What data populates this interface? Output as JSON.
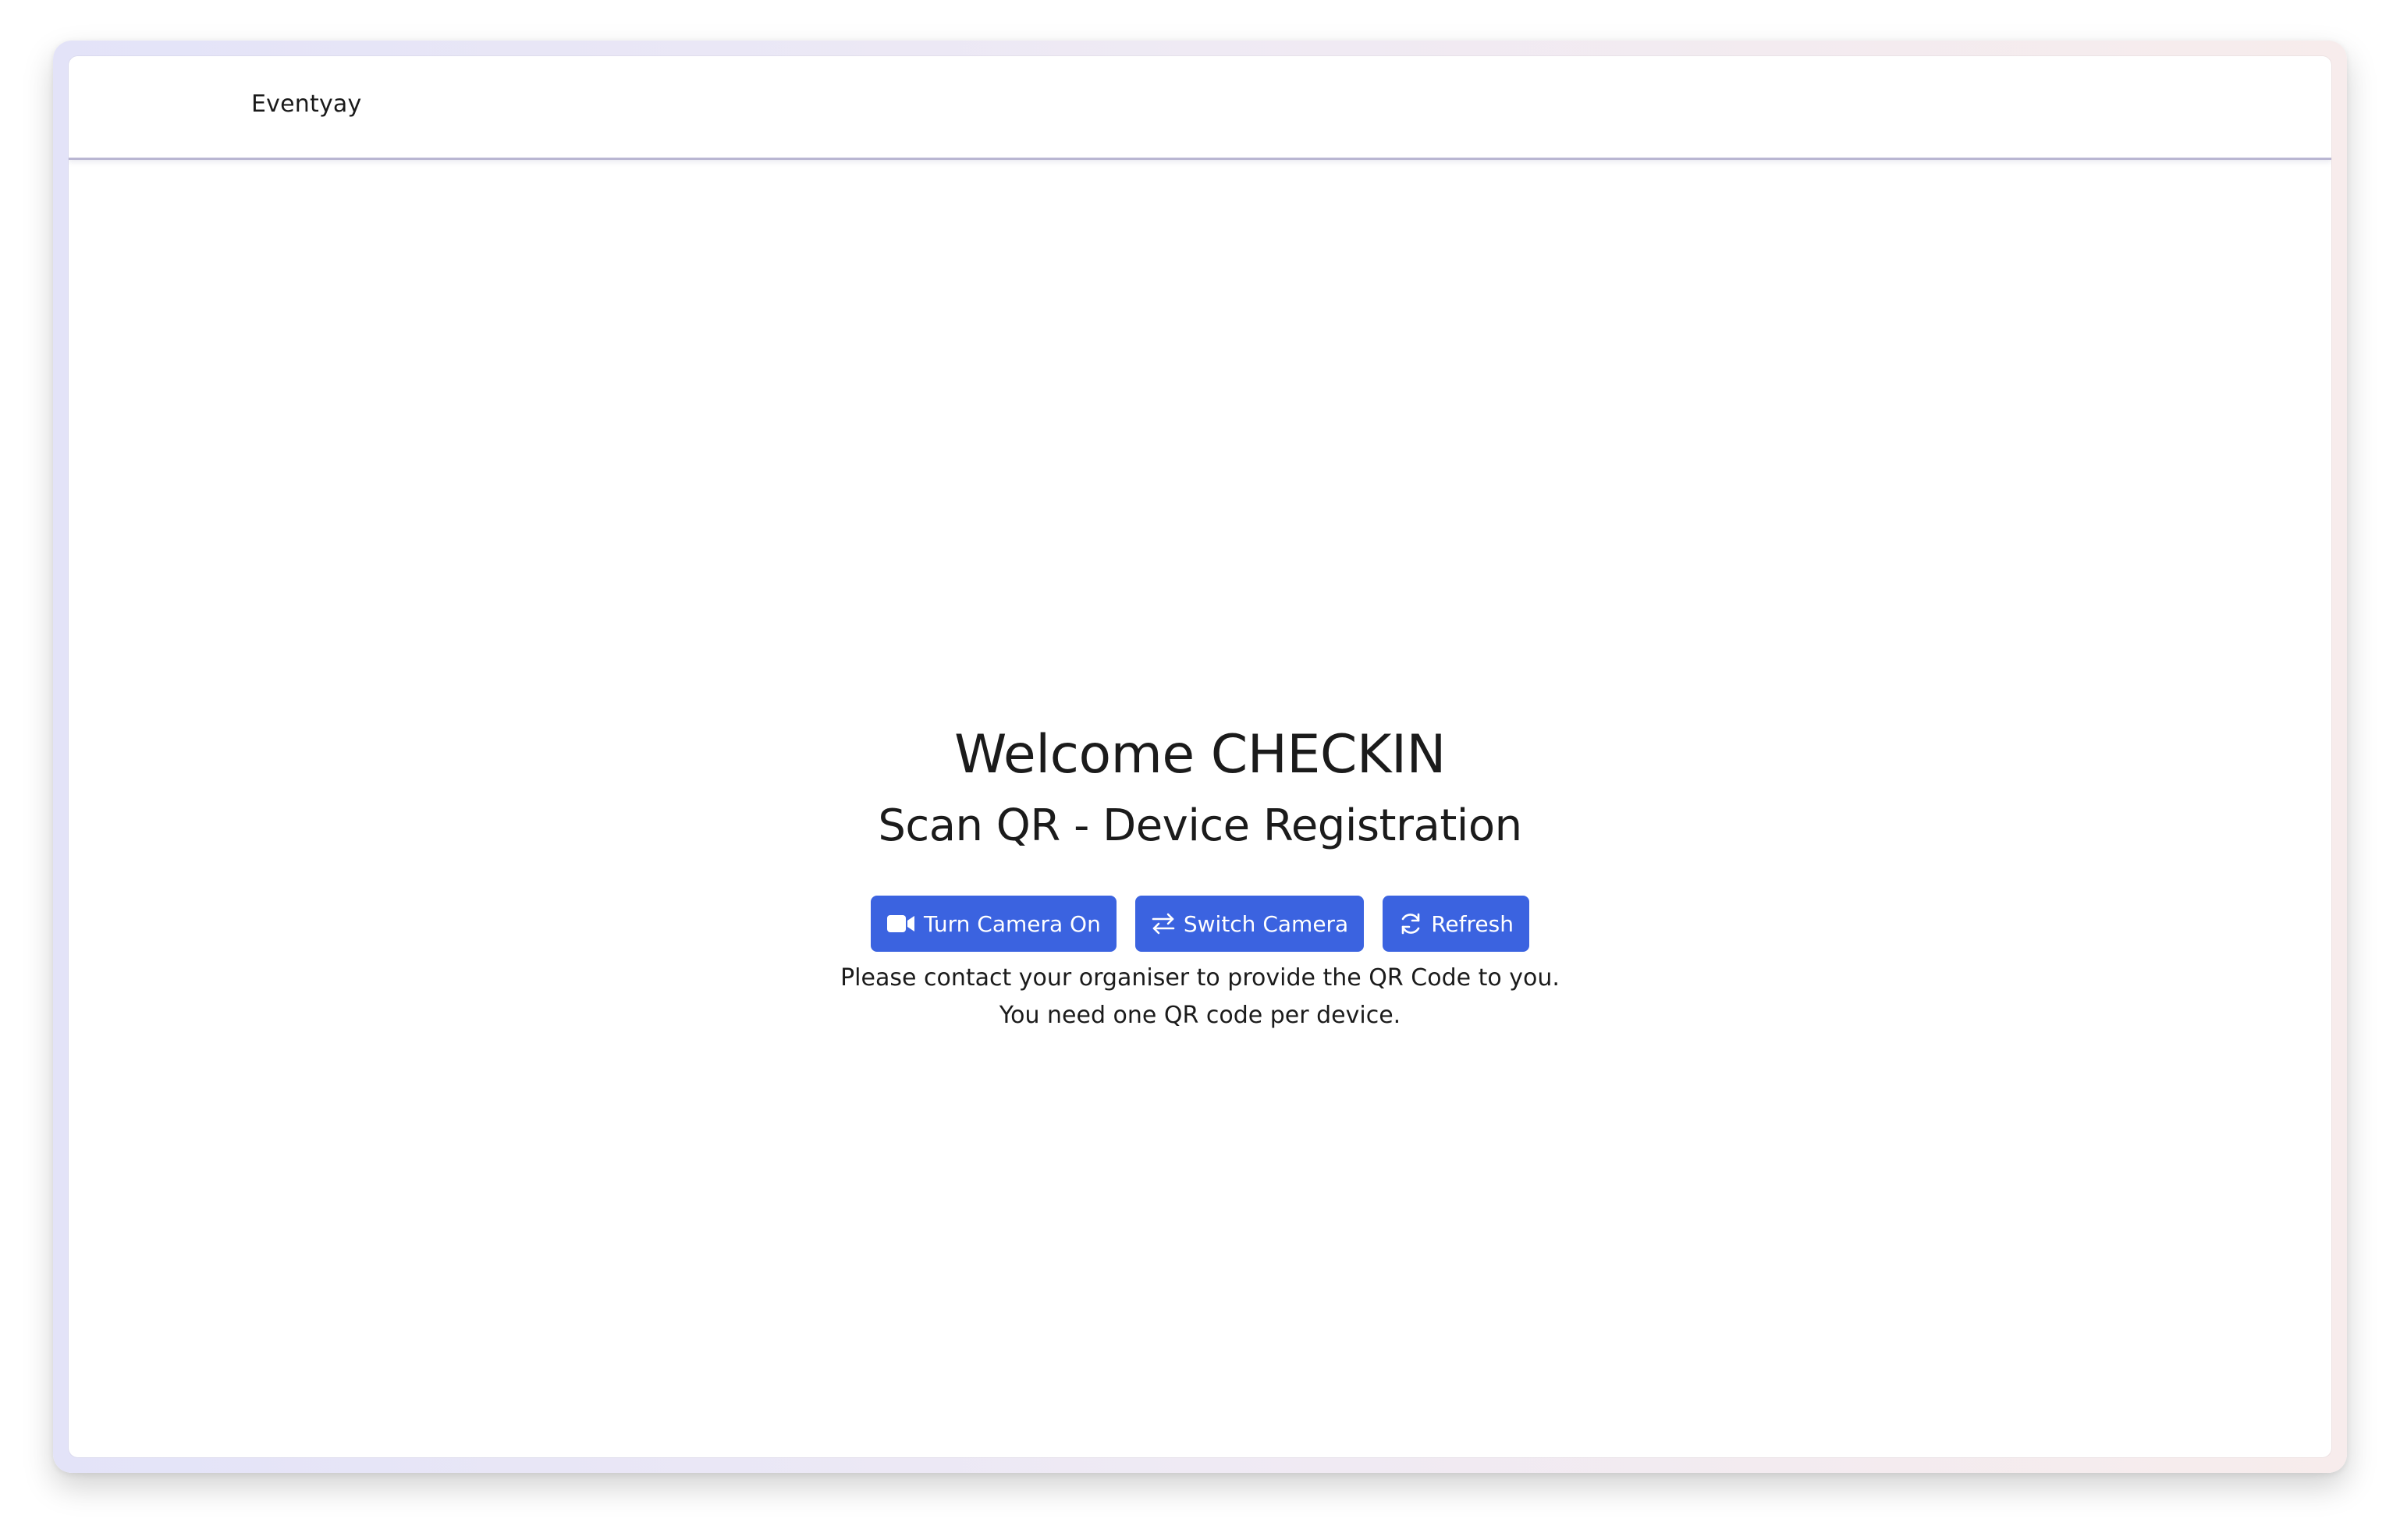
{
  "navbar": {
    "brand": "Eventyay"
  },
  "main": {
    "title": "Welcome CHECKIN",
    "subtitle": "Scan QR - Device Registration",
    "buttons": {
      "camera_on": {
        "label": "Turn Camera On",
        "icon": "video-camera-icon"
      },
      "switch_camera": {
        "label": "Switch Camera",
        "icon": "switch-arrows-icon"
      },
      "refresh": {
        "label": "Refresh",
        "icon": "refresh-icon"
      }
    },
    "note_line1": "Please contact your organiser to provide the QR Code to you.",
    "note_line2": "You need one QR code per device."
  },
  "colors": {
    "button_bg": "#3b63e0",
    "button_text": "#ffffff",
    "text": "#1b1b1b"
  }
}
